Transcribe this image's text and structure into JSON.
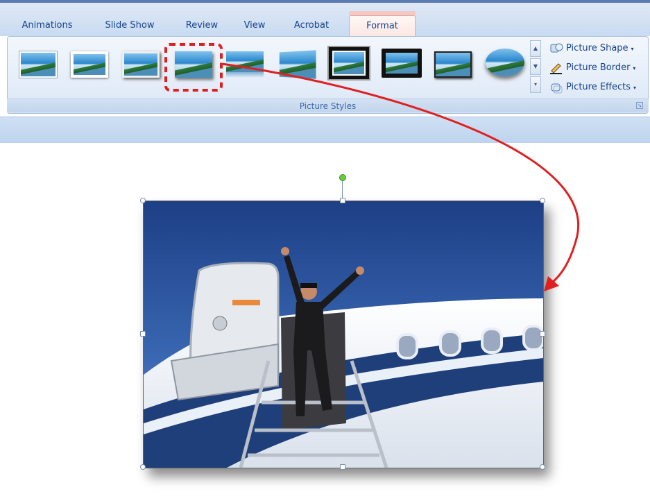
{
  "tabs": [
    {
      "label": "Animations"
    },
    {
      "label": "Slide Show"
    },
    {
      "label": "Review"
    },
    {
      "label": "View"
    },
    {
      "label": "Acrobat"
    },
    {
      "label": "Format",
      "active": true
    }
  ],
  "ribbon": {
    "group_label": "Picture Styles",
    "gallery": {
      "selected_index": 3,
      "styles": [
        {
          "icon": "simple-frame-style-thumbnail"
        },
        {
          "icon": "white-frame-style-thumbnail"
        },
        {
          "icon": "shadow-frame-style-thumbnail"
        },
        {
          "icon": "soft-edge-style-thumbnail"
        },
        {
          "icon": "reflection-style-thumbnail"
        },
        {
          "icon": "perspective-style-thumbnail"
        },
        {
          "icon": "thick-black-frame-style-thumbnail"
        },
        {
          "icon": "black-matte-style-thumbnail"
        },
        {
          "icon": "beveled-style-thumbnail"
        },
        {
          "icon": "oval-style-thumbnail"
        }
      ]
    },
    "commands": {
      "shape": "Picture Shape",
      "border": "Picture Border",
      "effects": "Picture Effects"
    }
  },
  "colors": {
    "accent_blue": "#15428b",
    "highlight_red": "#e02020",
    "rotate_handle_green": "#6ccb3c"
  }
}
